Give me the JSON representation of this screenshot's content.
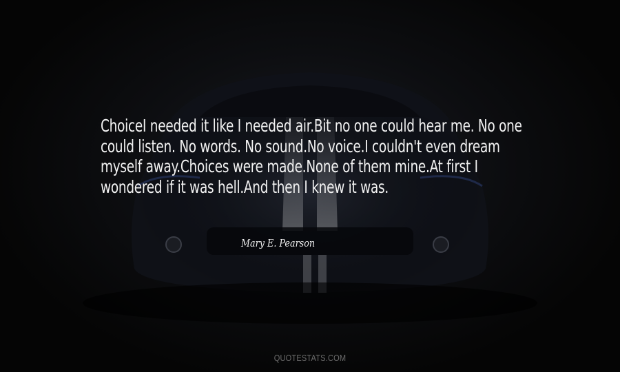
{
  "quote": {
    "text": "ChoiceI needed it like I needed air.Bit no one could hear me. No one could listen. No words. No sound.No voice.I couldn't even dream myself away.Choices were made.None of them mine.At first I wondered if it was hell.And then I knew it was.",
    "author": "Mary E. Pearson"
  },
  "watermark": {
    "text": "QUOTESTATS.COM"
  },
  "colors": {
    "background": "#050505",
    "text": "#f2f2f2",
    "watermark": "#6c6c6c"
  }
}
